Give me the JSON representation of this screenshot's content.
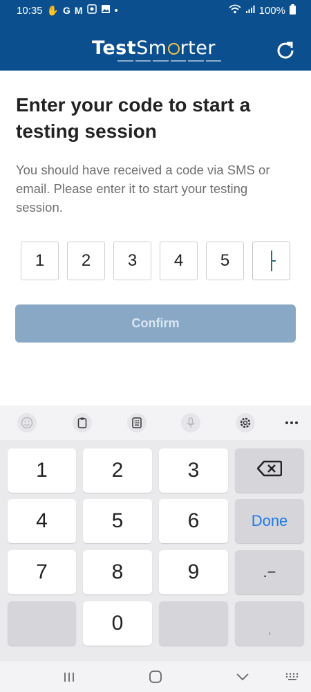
{
  "status_bar": {
    "time": "10:35",
    "left_glyphs": [
      "hand-icon",
      "G",
      "M",
      "outlook-icon",
      "image-icon",
      "•"
    ],
    "battery_text": "100%"
  },
  "app_bar": {
    "logo_text_bold": "Test",
    "logo_text_light_1": "Sm",
    "logo_text_light_2": "rter",
    "background_color": "#0b4f8f"
  },
  "main": {
    "title": "Enter your code to start a testing session",
    "subtitle": "You should have received a code via SMS or email. Please enter it to start your testing session.",
    "code_digits": [
      "1",
      "2",
      "3",
      "4",
      "5",
      ""
    ],
    "confirm_label": "Confirm"
  },
  "keyboard_toolbar": {
    "icons": [
      "emoji-icon",
      "clipboard-icon",
      "keypad-icon",
      "microphone-icon",
      "gear-icon",
      "more-icon"
    ]
  },
  "keyboard": {
    "keys": [
      [
        "1",
        "2",
        "3",
        "backspace"
      ],
      [
        "4",
        "5",
        "6",
        "Done"
      ],
      [
        "7",
        "8",
        "9",
        ".−"
      ],
      [
        "",
        "0",
        "",
        ","
      ]
    ],
    "done_label": "Done",
    "accent_color": "#1f7ae6"
  },
  "nav_bar": {
    "icons": [
      "recent-apps-icon",
      "home-icon",
      "back-icon",
      "keyboard-switch-icon"
    ]
  }
}
